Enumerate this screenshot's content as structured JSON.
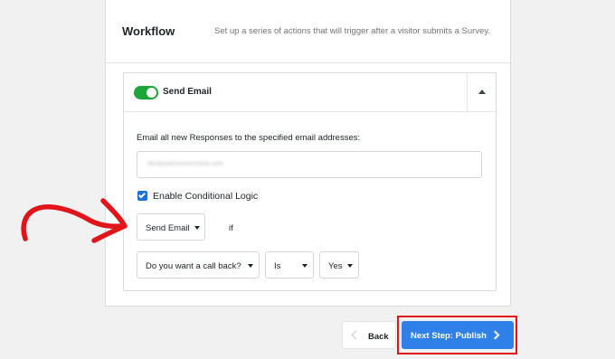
{
  "workflow": {
    "title": "Workflow",
    "description": "Set up a series of actions that will trigger after a visitor submits a Survey."
  },
  "action": {
    "enabled": true,
    "title": "Send Email",
    "collapse_icon": "caret-up-icon",
    "description": "Email all new Responses to the specified email addresses:",
    "email_value": "dev@awesomemotive.com",
    "conditional_checked": true,
    "conditional_label": "Enable Conditional Logic",
    "condition": {
      "action_select": "Send Email",
      "if_word": "if",
      "field_select": "Do you want a call back?",
      "operator_select": "Is",
      "value_select": "Yes"
    }
  },
  "footer": {
    "back_label": "Back",
    "next_label": "Next Step: Publish"
  },
  "colors": {
    "accent": "#2f80e8",
    "toggle_on": "#1ea53a",
    "annotation_red": "#e1141a"
  },
  "icons": {
    "back": "chevron-left-icon",
    "next": "chevron-right-icon",
    "annotation": "hand-drawn-arrow-icon"
  }
}
